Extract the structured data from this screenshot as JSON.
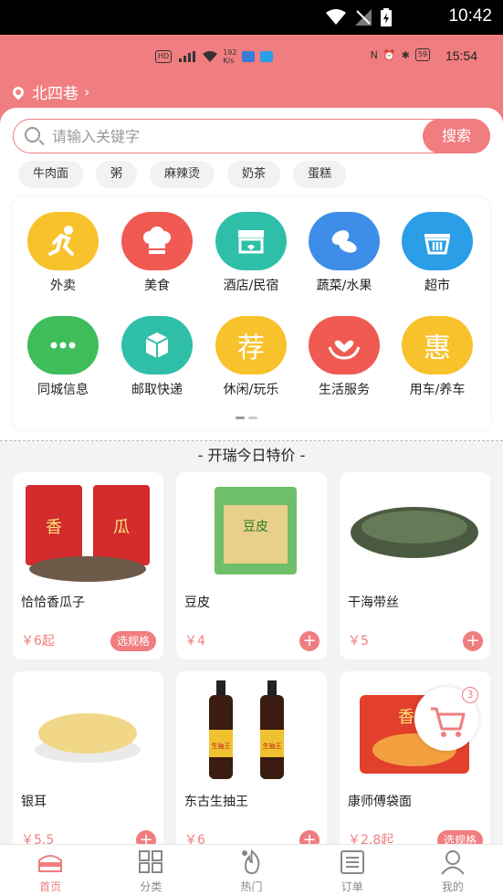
{
  "system_status": {
    "time": "10:42"
  },
  "inner_status": {
    "net_speed": "192\nK/s",
    "time": "15:54",
    "battery": "59"
  },
  "location": {
    "name": "北四巷",
    "chevron": "›"
  },
  "search": {
    "placeholder": "请输入关键字",
    "button": "搜索"
  },
  "hot_tags": [
    "牛肉面",
    "粥",
    "麻辣烫",
    "奶茶",
    "蛋糕"
  ],
  "categories": [
    {
      "label": "外卖",
      "icon": "running-man-icon",
      "color": "#f7c22c"
    },
    {
      "label": "美食",
      "icon": "chef-hat-icon",
      "color": "#f05a52"
    },
    {
      "label": "酒店/民宿",
      "icon": "storefront-icon",
      "color": "#2fbfa8"
    },
    {
      "label": "蔬菜/水果",
      "icon": "vegetables-icon",
      "color": "#3e8de8"
    },
    {
      "label": "超市",
      "icon": "basket-icon",
      "color": "#2a9ee6"
    },
    {
      "label": "同城信息",
      "icon": "chat-dots-icon",
      "color": "#3ebd5a"
    },
    {
      "label": "邮取快递",
      "icon": "package-icon",
      "color": "#2fbfa8"
    },
    {
      "label": "休闲/玩乐",
      "icon_text": "荐",
      "icon": "recommend-icon",
      "color": "#f7c22c"
    },
    {
      "label": "生活服务",
      "icon": "heart-hands-icon",
      "color": "#f05a52"
    },
    {
      "label": "用车/养车",
      "icon_text": "惠",
      "icon": "discount-icon",
      "color": "#f7c22c"
    }
  ],
  "section_title": "- 开瑞今日特价 -",
  "products": [
    {
      "name": "恰恰香瓜子",
      "price": "￥6起",
      "action": "选规格",
      "photo_text": "香瓜子"
    },
    {
      "name": "豆皮",
      "price": "￥4",
      "action": "+",
      "photo_text": "豆皮"
    },
    {
      "name": "干海带丝",
      "price": "￥5",
      "action": "+"
    },
    {
      "name": "银耳",
      "price": "￥5.5",
      "action": "+"
    },
    {
      "name": "东古生抽王",
      "price": "￥6",
      "action": "+",
      "photo_text": "生抽王"
    },
    {
      "name": "康师傅袋面",
      "price": "￥2.8起",
      "action": "选规格",
      "photo_text": "香辣"
    }
  ],
  "cart": {
    "count": "3"
  },
  "tabs": [
    {
      "label": "首页",
      "icon": "home-icon",
      "active": true
    },
    {
      "label": "分类",
      "icon": "grid-icon",
      "active": false
    },
    {
      "label": "热门",
      "icon": "fire-icon",
      "active": false
    },
    {
      "label": "订单",
      "icon": "order-icon",
      "active": false
    },
    {
      "label": "我的",
      "icon": "user-icon",
      "active": false
    }
  ],
  "colors": {
    "brand": "#f07d7f",
    "price": "#f07d7f"
  }
}
